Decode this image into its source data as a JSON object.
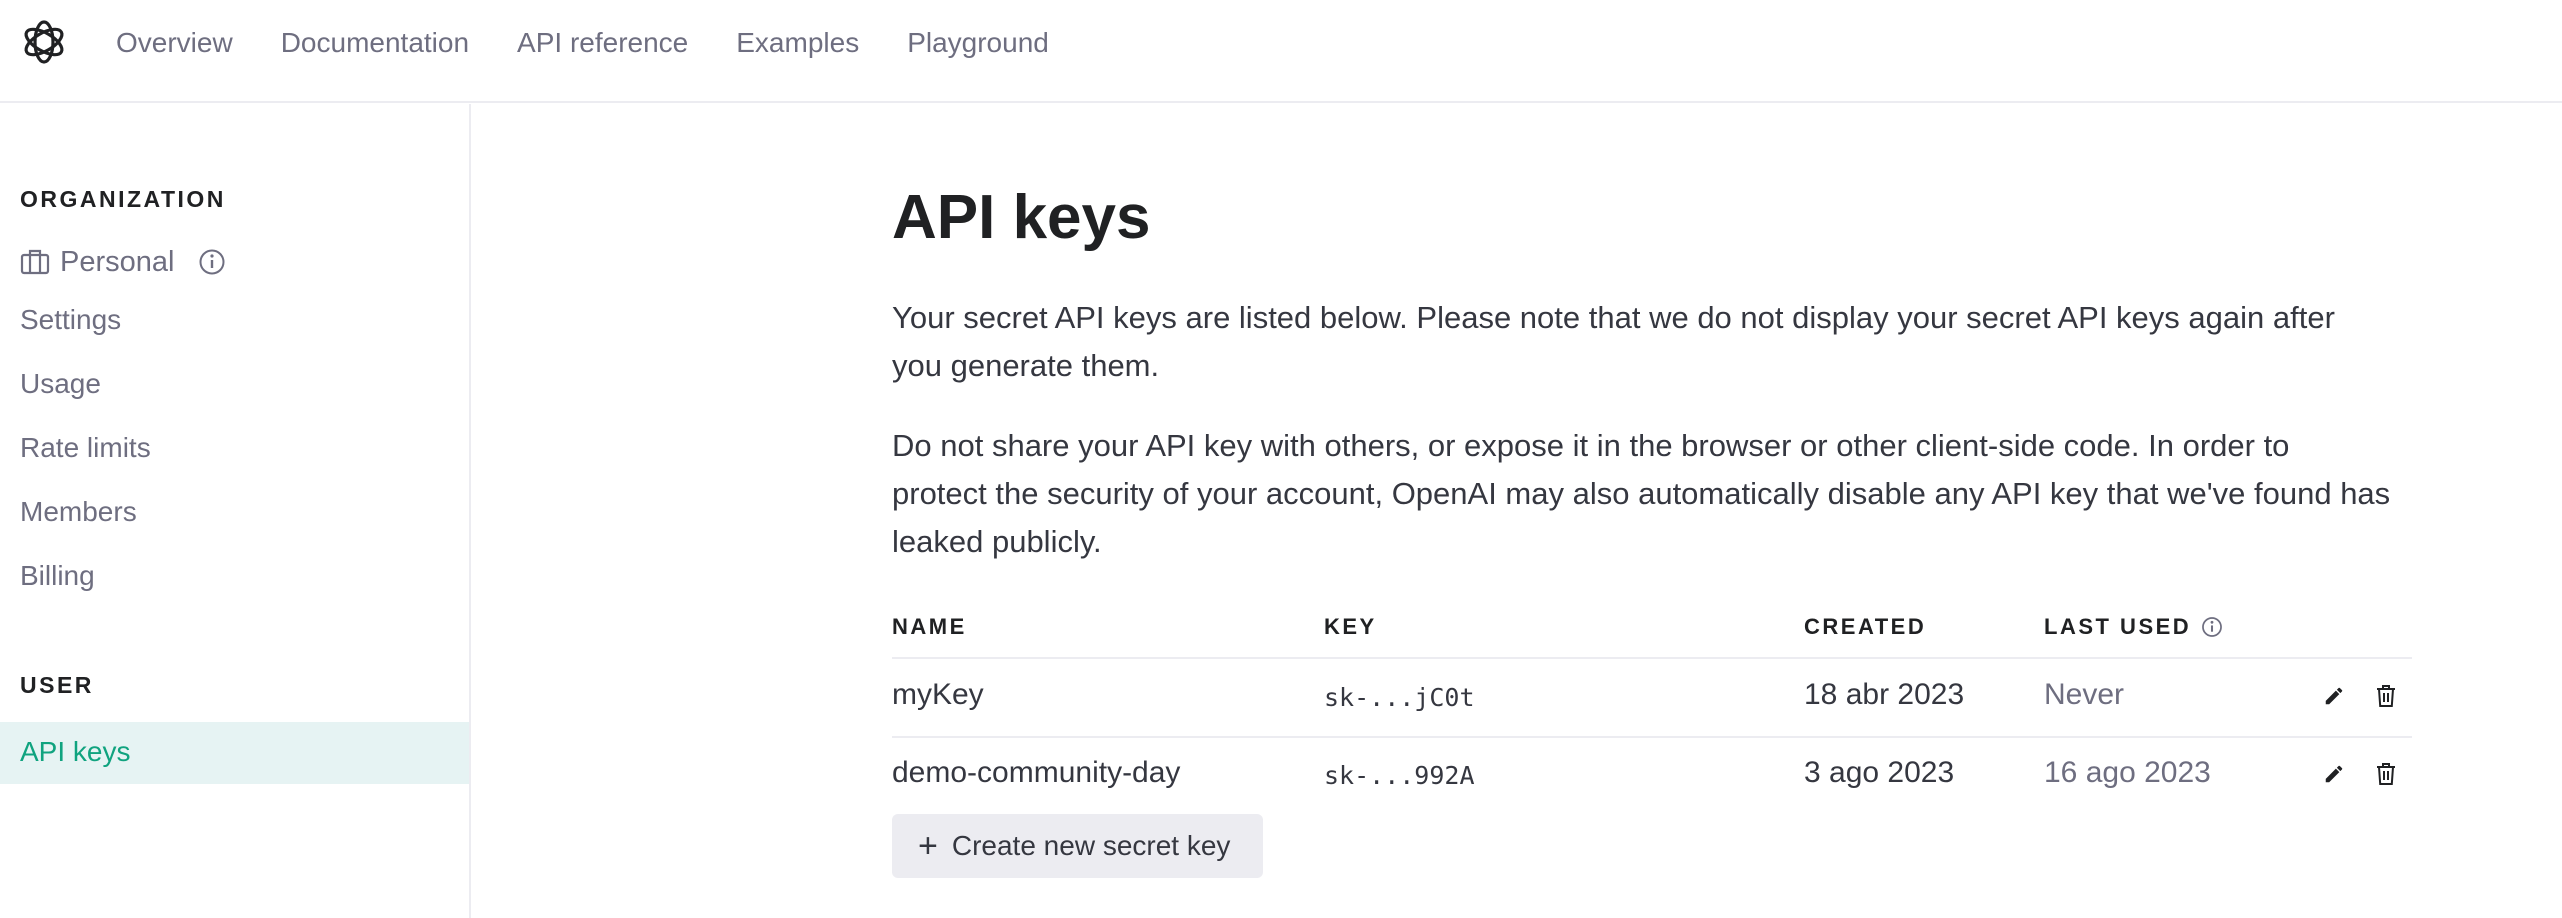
{
  "nav": {
    "links": [
      "Overview",
      "Documentation",
      "API reference",
      "Examples",
      "Playground"
    ]
  },
  "sidebar": {
    "org_heading": "ORGANIZATION",
    "org_name": "Personal",
    "items": [
      "Settings",
      "Usage",
      "Rate limits",
      "Members",
      "Billing"
    ],
    "user_heading": "USER",
    "active_item": "API keys"
  },
  "main": {
    "title": "API keys",
    "para1": "Your secret API keys are listed below. Please note that we do not display your secret API keys again after you generate them.",
    "para2": "Do not share your API key with others, or expose it in the browser or other client-side code. In order to protect the security of your account, OpenAI may also automatically disable any API key that we've found has leaked publicly.",
    "table": {
      "headers": [
        "NAME",
        "KEY",
        "CREATED",
        "LAST USED"
      ],
      "rows": [
        {
          "name": "myKey",
          "key": "sk-...jC0t",
          "created": "18 abr 2023",
          "last_used": "Never"
        },
        {
          "name": "demo-community-day",
          "key": "sk-...992A",
          "created": "3 ago 2023",
          "last_used": "16 ago 2023"
        }
      ]
    },
    "create_button": "Create new secret key"
  },
  "icons": {
    "logo": "openai-logo-icon",
    "org": "briefcase-icon",
    "info": "info-icon",
    "edit": "pencil-icon",
    "delete": "trash-icon"
  },
  "colors": {
    "accent": "#10a37f",
    "active_bg": "#e6f3f3",
    "muted_text": "#6e6e80",
    "heading_text": "#202123",
    "button_bg": "#ececf1"
  }
}
